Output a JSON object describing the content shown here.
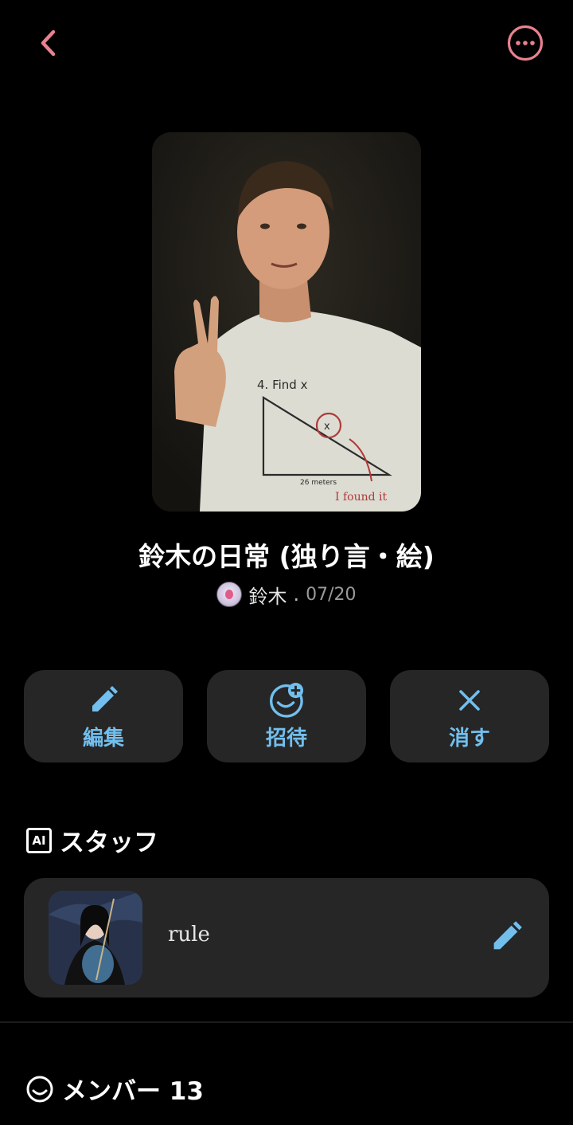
{
  "header": {
    "back_icon": "chevron-left-icon",
    "more_icon": "more-horizontal-circle-icon",
    "accent_color": "#e8828f"
  },
  "room": {
    "title": "鈴木の日常 (独り言・絵)",
    "owner_name": "鈴木",
    "separator": ".",
    "date": "07/20"
  },
  "actions": [
    {
      "label": "編集",
      "icon": "pencil-icon"
    },
    {
      "label": "招待",
      "icon": "invite-smile-plus-icon"
    },
    {
      "label": "消す",
      "icon": "close-icon"
    }
  ],
  "staff": {
    "badge": "AI",
    "heading": "スタッフ",
    "items": [
      {
        "name": "rule",
        "edit_icon": "pencil-icon"
      }
    ]
  },
  "members": {
    "heading": "メンバー 13",
    "icon": "smile-icon"
  },
  "colors": {
    "accent_blue": "#72bfee",
    "card_bg": "#262626"
  }
}
